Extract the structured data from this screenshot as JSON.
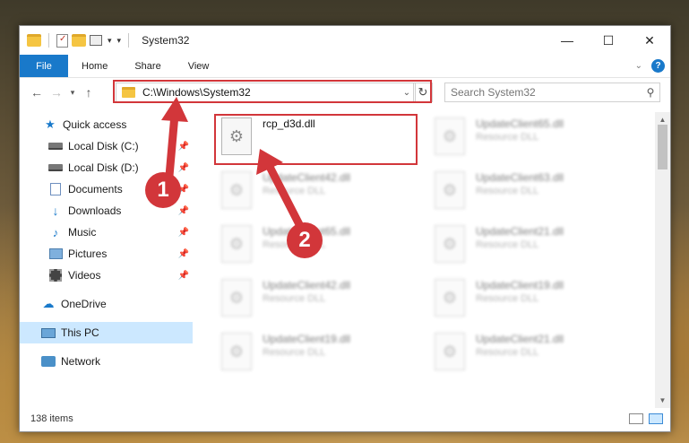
{
  "window": {
    "title": "System32",
    "controls": {
      "minimize": "—",
      "maximize": "☐",
      "close": "✕"
    }
  },
  "ribbon": {
    "tabs": [
      {
        "label": "File"
      },
      {
        "label": "Home"
      },
      {
        "label": "Share"
      },
      {
        "label": "View"
      }
    ],
    "help": "?"
  },
  "navigation": {
    "address": "C:\\Windows\\System32",
    "search_placeholder": "Search System32"
  },
  "sidebar": {
    "items": [
      {
        "label": "Quick access",
        "icon": "star-icon"
      },
      {
        "label": "Local Disk (C:)",
        "icon": "disk-icon",
        "pinned": true
      },
      {
        "label": "Local Disk (D:)",
        "icon": "disk-icon",
        "pinned": true
      },
      {
        "label": "Documents",
        "icon": "documents-icon",
        "pinned": true
      },
      {
        "label": "Downloads",
        "icon": "downloads-icon",
        "pinned": true
      },
      {
        "label": "Music",
        "icon": "music-icon",
        "pinned": true
      },
      {
        "label": "Pictures",
        "icon": "pictures-icon",
        "pinned": true
      },
      {
        "label": "Videos",
        "icon": "videos-icon",
        "pinned": true
      },
      {
        "label": "OneDrive",
        "icon": "onedrive-icon"
      },
      {
        "label": "This PC",
        "icon": "this-pc-icon",
        "selected": true
      },
      {
        "label": "Network",
        "icon": "network-icon"
      }
    ]
  },
  "files": [
    {
      "name": "rcp_d3d.dll",
      "type": ""
    },
    {
      "name": "UpdateClient65.dll",
      "type": "Resource DLL"
    },
    {
      "name": "UpdateClient42.dll",
      "type": "Resource DLL"
    },
    {
      "name": "UpdateClient63.dll",
      "type": "Resource DLL"
    },
    {
      "name": "UpdateClient65.dll",
      "type": "Resource DLL"
    },
    {
      "name": "UpdateClient21.dll",
      "type": "Resource DLL"
    },
    {
      "name": "UpdateClient42.dll",
      "type": "Resource DLL"
    },
    {
      "name": "UpdateClient19.dll",
      "type": "Resource DLL"
    },
    {
      "name": "UpdateClient19.dll",
      "type": "Resource DLL"
    },
    {
      "name": "UpdateClient21.dll",
      "type": "Resource DLL"
    }
  ],
  "status": {
    "count": "138 items"
  },
  "annotations": {
    "badge1": "1",
    "badge2": "2",
    "color": "#d2363a"
  }
}
